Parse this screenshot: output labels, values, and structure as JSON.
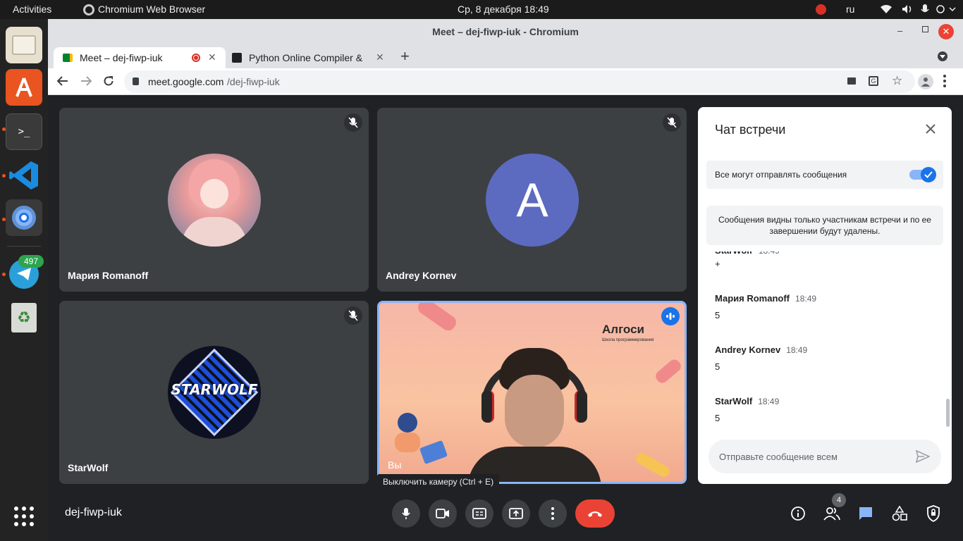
{
  "topbar": {
    "activities": "Activities",
    "app_name": "Chromium Web Browser",
    "datetime": "Ср, 8 декабря  18:49",
    "lang": "ru"
  },
  "dock": {
    "telegram_badge": "497"
  },
  "window": {
    "title": "Meet – dej-fiwp-iuk - Chromium"
  },
  "tabs": [
    {
      "label": "Meet – dej-fiwp-iuk"
    },
    {
      "label": "Python Online Compiler &"
    }
  ],
  "address": {
    "host": "meet.google.com",
    "path": "/dej-fiwp-iuk"
  },
  "tiles": [
    {
      "name": "Мария Romanoff"
    },
    {
      "name": "Andrey Kornev",
      "avatar_letter": "A"
    },
    {
      "name": "StarWolf",
      "avatar_text": "STARWOLF"
    },
    {
      "name": "Вы",
      "sign_text": "Алгоси",
      "sign_sub": "Школа программирования"
    }
  ],
  "chat": {
    "title": "Чат встречи",
    "toggle_label": "Все могут отправлять сообщения",
    "toggle_on": true,
    "notice": "Сообщения видны только участникам встречи и по ее завершении будут удалены.",
    "partial_text": "+",
    "messages": [
      {
        "name": "Мария Romanoff",
        "time": "18:49",
        "text": "5"
      },
      {
        "name": "Andrey Kornev",
        "time": "18:49",
        "text": "5"
      },
      {
        "name": "StarWolf",
        "time": "18:49",
        "text": "5"
      }
    ],
    "input_placeholder": "Отправьте сообщение всем"
  },
  "meeting": {
    "code": "dej-fiwp-iuk",
    "tooltip": "Выключить камеру (Ctrl + E)",
    "participants_count": "4"
  },
  "colors": {
    "meet_bg": "#202124",
    "tile_bg": "#3c4043",
    "end_call": "#ea4335",
    "accent_blue": "#1a73e8",
    "chat_icon": "#8ab4f8",
    "avatar_a": "#5c6bc0"
  }
}
